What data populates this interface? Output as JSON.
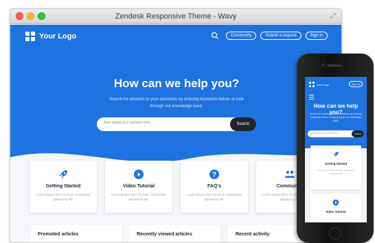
{
  "window": {
    "title": "Zendesk Responsive Theme - Wavy"
  },
  "header": {
    "logo_text": "Your Logo",
    "nav": [
      "Community",
      "Submit a request",
      "Sign in"
    ]
  },
  "hero": {
    "title": "How can we help you?",
    "subtitle": "Search for answers to your questions by entering keywords below, or look through our knowledge base.",
    "search_placeholder": "Start typing your question here...",
    "search_button": "Search"
  },
  "cards": [
    {
      "title": "Getting Started",
      "desc": "Lorem ipsum dolor sit amet, consectetur adipisicing elit.",
      "icon": "rocket-icon"
    },
    {
      "title": "Video Tutorial",
      "desc": "Lorem ipsum dolor sit amet, consectetur adipisicing elit.",
      "icon": "play-icon"
    },
    {
      "title": "FAQ's",
      "desc": "Lorem ipsum dolor sit amet, consectetur adipisicing elit.",
      "icon": "question-icon"
    },
    {
      "title": "Community",
      "desc": "Lorem ipsum dolor sit amet, consectetur adipisicing elit.",
      "icon": "people-icon"
    }
  ],
  "sections": [
    "Promoted articles",
    "Recently viewed articles",
    "Recent activity"
  ],
  "phone": {
    "logo_text": "Your Logo",
    "signin": "Sign in",
    "title": "How can we help you?",
    "subtitle": "Search for answers to your questions by entering keywords below, or look through our knowledge base.",
    "search_placeholder": "Start typing your question here...",
    "search_button": "Search",
    "cards": [
      {
        "title": "Getting Started",
        "desc": "Lorem ipsum dolor sit amet, consectetur adipisicing elit."
      },
      {
        "title": "Video Tutorial"
      }
    ]
  },
  "colors": {
    "brand": "#1f73e0",
    "dark": "#1f2430"
  }
}
